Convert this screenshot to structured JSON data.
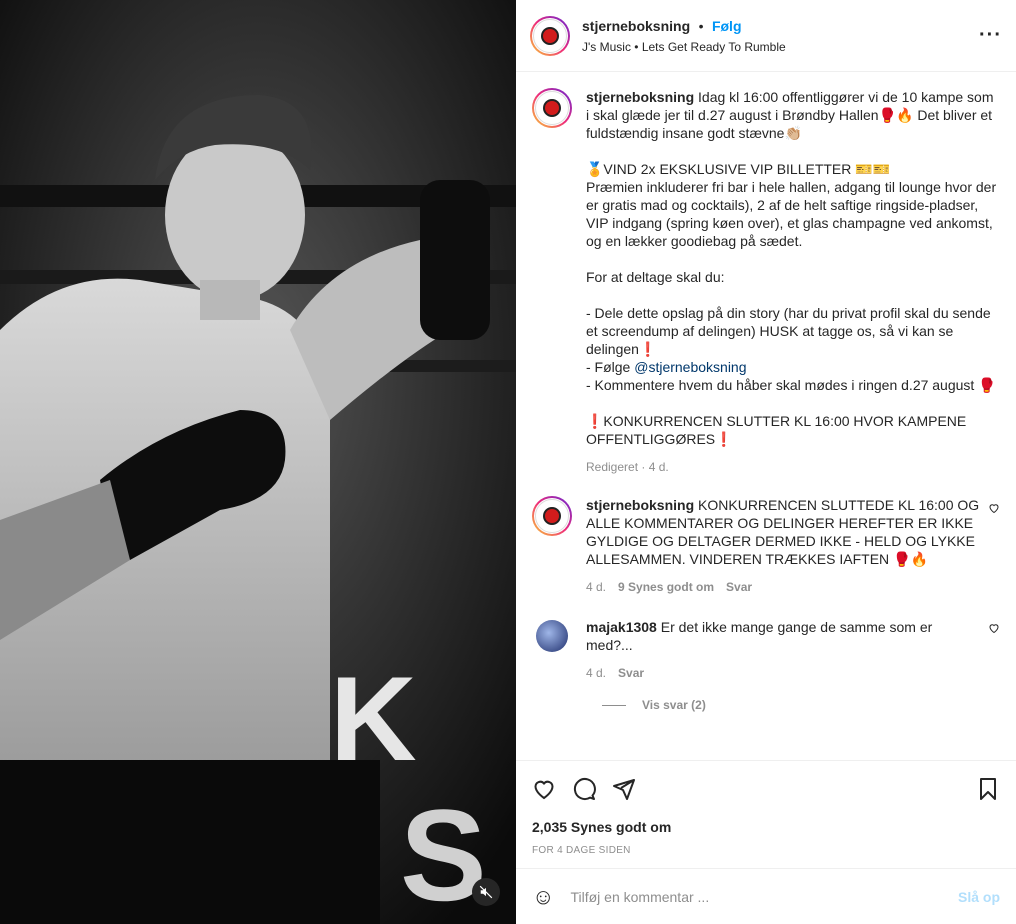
{
  "header": {
    "username": "stjerneboksning",
    "separator": "•",
    "follow_label": "Følg",
    "music": "J's Music • Lets Get Ready To Rumble",
    "more": "···"
  },
  "caption": {
    "username": "stjerneboksning",
    "text": " Idag kl 16:00 offentliggører vi de 10 kampe som i skal glæde jer til d.27 august i Brøndby Hallen🥊🔥 Det bliver et fuldstændig insane godt stævne👏🏼\n\n🏅VIND 2x EKSKLUSIVE VIP BILLETTER 🎫🎫\nPræmien inkluderer fri bar i hele hallen, adgang til lounge hvor der er gratis mad og cocktails), 2 af de helt saftige ringside-pladser, VIP indgang (spring køen over), et glas champagne ved ankomst, og en lækker goodiebag på sædet.\n\nFor at deltage skal du:\n\n- Dele dette opslag på din story (har du privat profil skal du sende et screendump af delingen) HUSK at tagge os, så vi kan se delingen❗\n- Følge ",
    "mention": "@stjerneboksning",
    "text2": "\n- Kommentere hvem du håber skal mødes i ringen d.27 august 🥊\n\n❗KONKURRENCEN SLUTTER KL 16:00 HVOR KAMPENE OFFENTLIGGØRES❗",
    "meta": "Redigeret · 4 d."
  },
  "comments": [
    {
      "username": "stjerneboksning",
      "text": " KONKURRENCEN SLUTTEDE KL 16:00 OG ALLE KOMMENTARER OG DELINGER HEREFTER ER IKKE GYLDIGE OG DELTAGER DERMED IKKE - HELD OG LYKKE ALLESAMMEN. VINDEREN TRÆKKES IAFTEN 🥊🔥",
      "time": "4 d.",
      "likes": "9 Synes godt om",
      "reply": "Svar"
    },
    {
      "username": "majak1308",
      "text": " Er det ikke mange gange de samme som er med?...",
      "time": "4 d.",
      "reply": "Svar",
      "view_replies": "Vis svar (2)"
    }
  ],
  "footer": {
    "likes": "2,035 Synes godt om",
    "time": "FOR 4 DAGE SIDEN",
    "comment_placeholder": "Tilføj en kommentar ...",
    "post_label": "Slå op"
  }
}
